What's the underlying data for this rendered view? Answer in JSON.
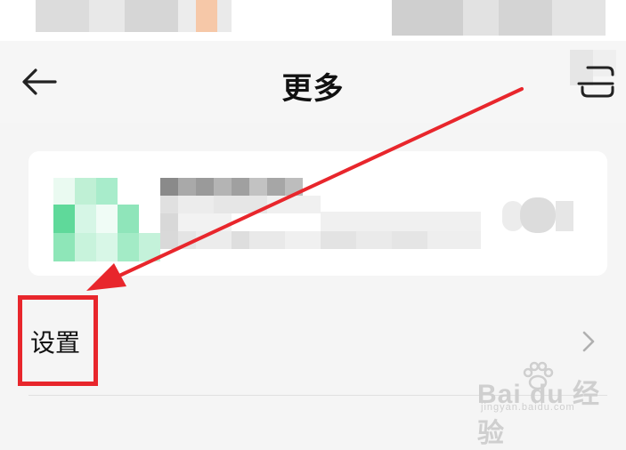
{
  "header": {
    "title": "更多"
  },
  "settings": {
    "label": "设置"
  },
  "watermark": {
    "brand": "Bai du 经验",
    "site": "jingyan.baidu.com"
  },
  "colors": {
    "annotation": "#e8262c",
    "background": "#f5f5f5",
    "card": "#ffffff"
  },
  "icons": {
    "back": "arrow-left-icon",
    "scan": "scan-icon",
    "chevron": "chevron-right-icon"
  }
}
